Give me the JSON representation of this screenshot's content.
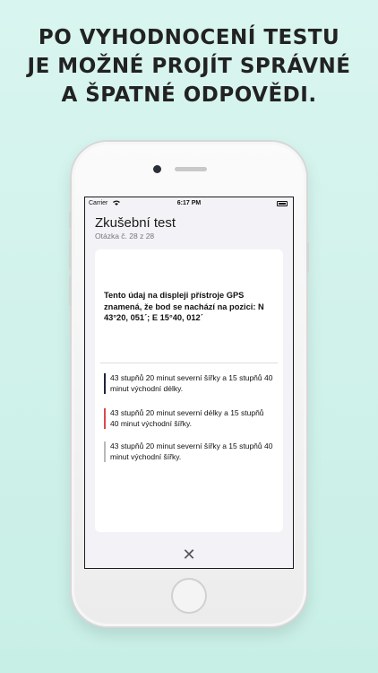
{
  "headline": {
    "line1": "PO VYHODNOCENÍ TESTU",
    "line2": "JE MOŽNÉ PROJÍT SPRÁVNÉ",
    "line3": "A ŠPATNÉ ODPOVĚDI."
  },
  "status_bar": {
    "carrier": "Carrier",
    "time": "6:17 PM",
    "wifi_icon": "wifi-icon",
    "battery_icon": "battery-icon"
  },
  "screen": {
    "title": "Zkušební test",
    "subtitle": "Otázka č. 28 z 28",
    "question": "Tento údaj na displeji přístroje GPS znamená, že bod se nachází na pozici: N 43°20, 051´; E 15°40, 012´",
    "answers": [
      {
        "text": "43 stupňů 20 minut severní šířky a 15 stupňů 40 minut východní délky.",
        "color": "#1f2340"
      },
      {
        "text": "43 stupňů 20 minut severní délky a 15 stupňů 40 minut východní šířky.",
        "color": "#d94a4a"
      },
      {
        "text": "43 stupňů 20 minut severní šířky a 15 stupňů 40 minut východní šířky.",
        "color": "#b9b9b9"
      }
    ],
    "close_icon": "close-icon",
    "close_glyph": "✕"
  },
  "colors": {
    "background": "#d9f5ef",
    "correct": "#1f2340",
    "wrong": "#d94a4a",
    "neutral": "#b9b9b9"
  }
}
